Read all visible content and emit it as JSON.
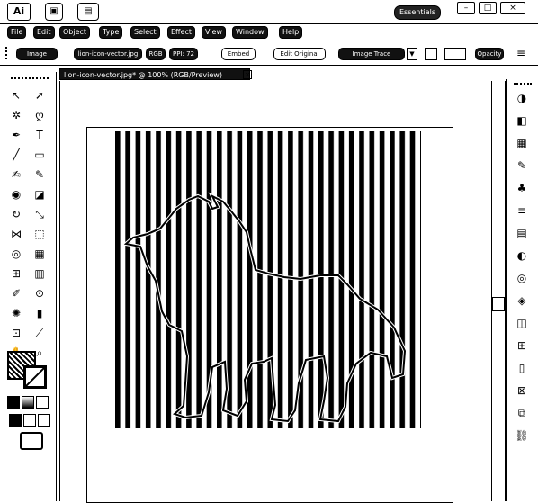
{
  "app": {
    "logo": "Ai"
  },
  "topbar": {
    "workspace": "Essentials"
  },
  "menus": [
    "File",
    "Edit",
    "Object",
    "Type",
    "Select",
    "Effect",
    "View",
    "Window",
    "Help"
  ],
  "controlbar": {
    "image_label": "Image",
    "file_name": "lion-icon-vector.jpg",
    "color_mode": "RGB",
    "ppi": "PPI: 72",
    "embed": "Embed",
    "edit_original": "Edit Original",
    "image_trace": "Image Trace",
    "opacity": "Opacity"
  },
  "document": {
    "tab_title": "lion-icon-vector.jpg* @ 100% (RGB/Preview)",
    "close": "×"
  },
  "colors": {
    "ink": "#000000",
    "paper": "#ffffff"
  },
  "tools": [
    "selection-icon",
    "direct-selection-icon",
    "magic-wand-icon",
    "lasso-icon",
    "pen-icon",
    "type-icon",
    "line-icon",
    "rectangle-icon",
    "paintbrush-icon",
    "pencil-icon",
    "blob-brush-icon",
    "eraser-icon",
    "rotate-icon",
    "scale-icon",
    "width-icon",
    "free-transform-icon",
    "shape-builder-icon",
    "perspective-grid-icon",
    "mesh-icon",
    "gradient-icon",
    "eyedropper-icon",
    "blend-icon",
    "symbol-sprayer-icon",
    "column-graph-icon",
    "artboard-icon",
    "slice-icon",
    "hand-icon",
    "zoom-icon"
  ],
  "panels": [
    "color-icon",
    "color-guide-icon",
    "swatches-icon",
    "brushes-icon",
    "symbols-icon",
    "stroke-icon",
    "gradient-panel-icon",
    "transparency-icon",
    "appearance-icon",
    "graphic-styles-icon",
    "layers-icon",
    "artboards-icon",
    "align-icon",
    "transform-icon",
    "pathfinder-icon",
    "links-icon"
  ],
  "artwork": {
    "subject": "lion",
    "stripes": 30
  }
}
